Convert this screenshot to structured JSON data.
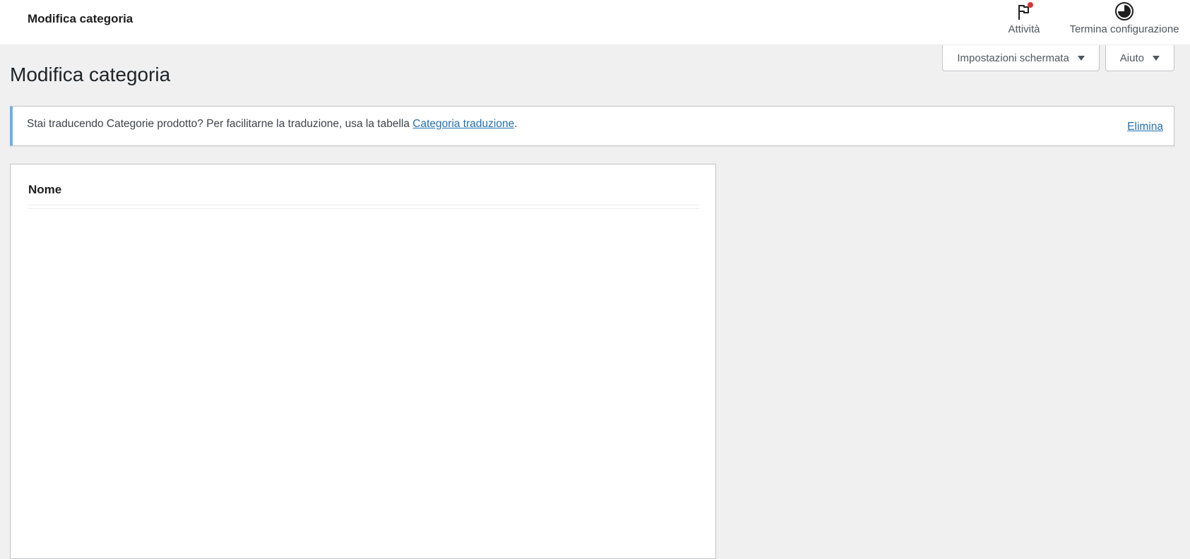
{
  "topbar": {
    "title": "Modifica categoria",
    "activity": {
      "label": "Attività",
      "icon": "flag-icon"
    },
    "setup": {
      "label": "Termina configurazione",
      "icon": "progress-circle-icon"
    }
  },
  "screen_options": {
    "screen_settings_label": "Impostazioni schermata",
    "help_label": "Aiuto"
  },
  "page": {
    "title": "Modifica categoria"
  },
  "notice": {
    "text_before": "Stai traducendo Categorie prodotto? Per facilitarne la traduzione, usa la tabella ",
    "link_label": "Categoria traduzione",
    "text_after": ".",
    "dismiss_label": "Elimina"
  },
  "form": {
    "name_label": "Nome"
  },
  "colors": {
    "accent": "#2271b1",
    "notice_border": "#72aee6",
    "badge": "#d63638"
  }
}
